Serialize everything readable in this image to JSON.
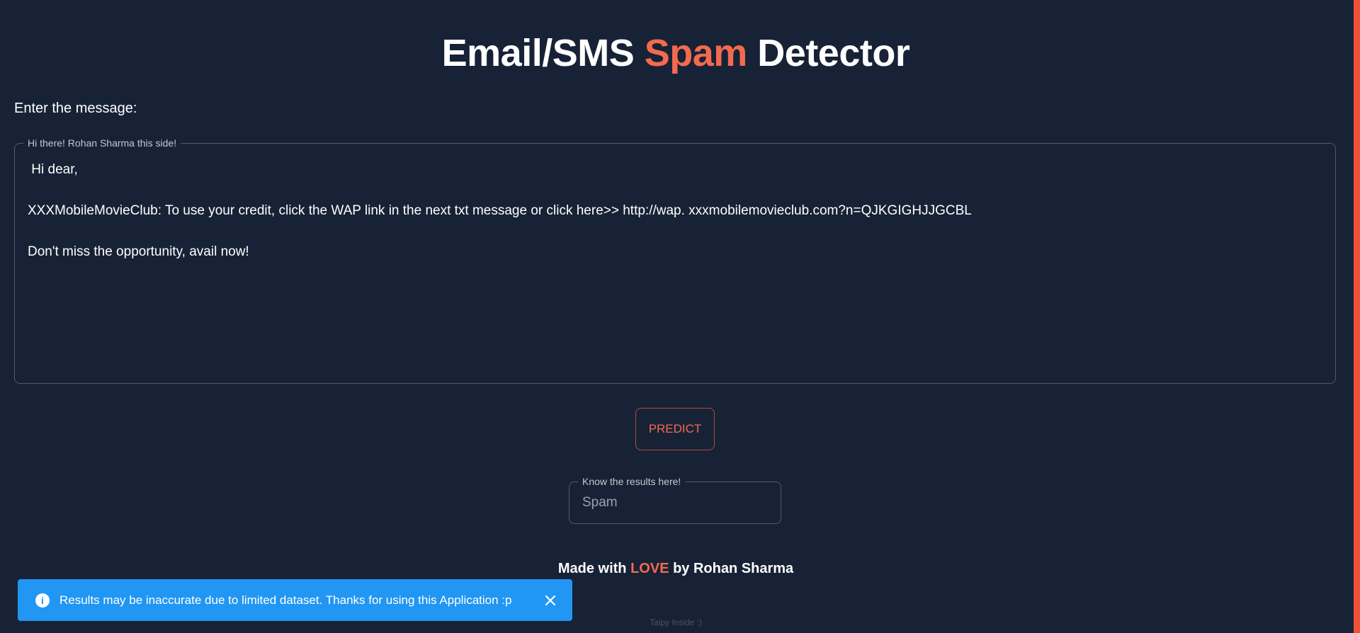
{
  "header": {
    "title_part1": "Email/SMS ",
    "title_accent": "Spam",
    "title_part2": " Detector"
  },
  "form": {
    "prompt_label": "Enter the message:",
    "message_legend": "Hi there! Rohan Sharma this side!",
    "message_value": " Hi dear,\n\nXXXMobileMovieClub: To use your credit, click the WAP link in the next txt message or click here>> http://wap. xxxmobilemovieclub.com?n=QJKGIGHJJGCBL\n\nDon't miss the opportunity, avail now!",
    "predict_label": "PREDICT",
    "result_legend": "Know the results here!",
    "result_value": "Spam"
  },
  "footer": {
    "made_with": "Made with ",
    "love": "LOVE",
    "by": " by Rohan Sharma",
    "taipy": "Taipy Inside :)"
  },
  "toast": {
    "message": "Results may be inaccurate due to limited dataset. Thanks for using this Application :p",
    "icon": "info-icon",
    "close_icon": "close-icon"
  },
  "colors": {
    "background": "#172236",
    "accent": "#f36a4f",
    "toast": "#2196f3"
  }
}
